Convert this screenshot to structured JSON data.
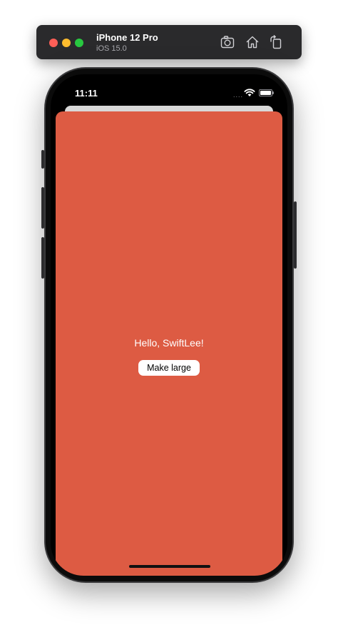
{
  "simulator": {
    "device_name": "iPhone 12 Pro",
    "os_version": "iOS 15.0"
  },
  "status_bar": {
    "time": "11:11",
    "dots": "....",
    "battery_level": 1.0
  },
  "content": {
    "greeting": "Hello, SwiftLee!",
    "button_label": "Make large",
    "background_color": "#dd5b43"
  },
  "icons": {
    "toolbar": [
      "screenshot-icon",
      "home-icon",
      "rotate-icon"
    ],
    "status": [
      "wifi-icon",
      "battery-icon"
    ]
  }
}
